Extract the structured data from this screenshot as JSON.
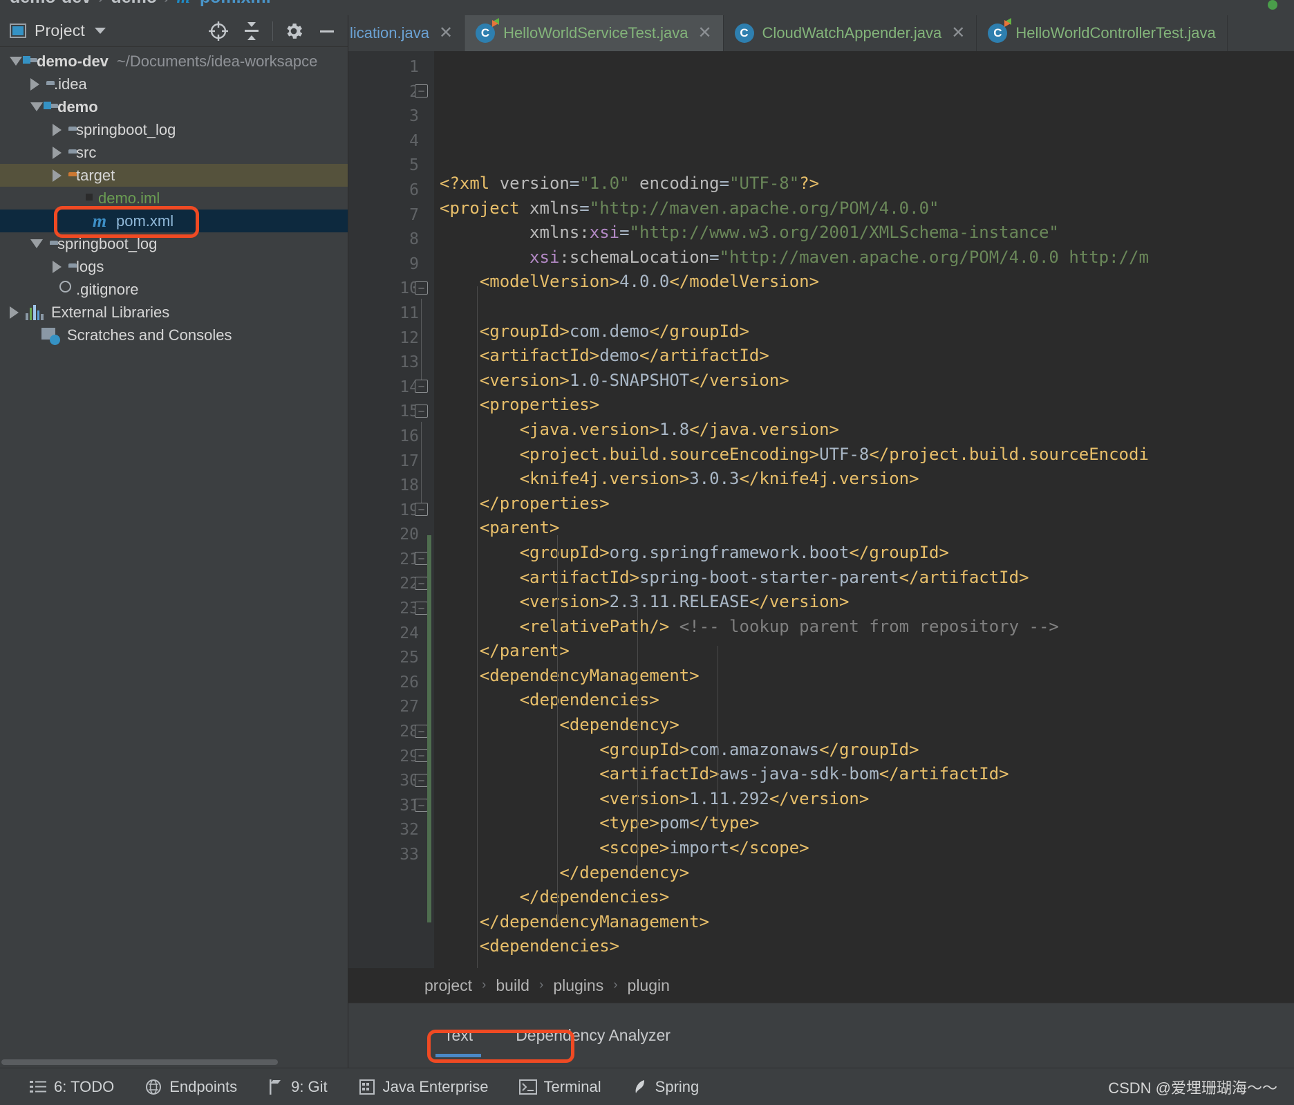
{
  "window": {
    "top_breadcrumb": {
      "project": "demo-dev",
      "module": "demo",
      "file": "pom.xml",
      "separator": "›",
      "maven_icon": "m"
    }
  },
  "project_panel": {
    "title": "Project",
    "window_icon": "project-window-icon",
    "dropdown_icon": "chevron-down-icon",
    "actions": [
      {
        "name": "locate-icon",
        "label": "⊕"
      },
      {
        "name": "collapse-all-icon",
        "label": "⇟"
      },
      {
        "name": "settings-gear-icon",
        "label": "⚙"
      },
      {
        "name": "hide-panel-icon",
        "label": "—"
      }
    ],
    "tree": [
      {
        "label": "demo-dev",
        "path": "~/Documents/idea-worksapce",
        "icon": "module-folder-icon",
        "twist": "open",
        "indent": 0,
        "style": "bold",
        "state": "normal"
      },
      {
        "label": ".idea",
        "path": "",
        "icon": "folder-icon",
        "twist": "closed",
        "indent": 1,
        "style": "normal",
        "state": "normal"
      },
      {
        "label": "demo",
        "path": "",
        "icon": "module-folder-icon",
        "twist": "open",
        "indent": 1,
        "style": "bold",
        "state": "normal"
      },
      {
        "label": "springboot_log",
        "path": "",
        "icon": "folder-icon",
        "twist": "closed",
        "indent": 2,
        "style": "normal",
        "state": "normal"
      },
      {
        "label": "src",
        "path": "",
        "icon": "folder-icon",
        "twist": "closed",
        "indent": 2,
        "style": "normal",
        "state": "normal"
      },
      {
        "label": "target",
        "path": "",
        "icon": "folder-orange-icon",
        "twist": "closed",
        "indent": 2,
        "style": "normal",
        "state": "selected-dir"
      },
      {
        "label": "demo.iml",
        "path": "",
        "icon": "iml-file-icon",
        "twist": "none",
        "indent": 3,
        "style": "green",
        "state": "normal"
      },
      {
        "label": "pom.xml",
        "path": "",
        "icon": "maven-file-icon",
        "twist": "none",
        "indent": 3,
        "style": "bluefile",
        "state": "selected-file"
      },
      {
        "label": "springboot_log",
        "path": "",
        "icon": "folder-icon",
        "twist": "open",
        "indent": 1,
        "style": "normal",
        "state": "normal"
      },
      {
        "label": "logs",
        "path": "",
        "icon": "folder-icon",
        "twist": "closed",
        "indent": 2,
        "style": "normal",
        "state": "normal"
      },
      {
        "label": ".gitignore",
        "path": "",
        "icon": "gitignore-file-icon",
        "twist": "none",
        "indent": 2,
        "style": "normal",
        "state": "normal"
      },
      {
        "label": "External Libraries",
        "path": "",
        "icon": "external-libraries-icon",
        "twist": "closed",
        "indent": 0,
        "style": "normal",
        "state": "normal"
      },
      {
        "label": "Scratches and Consoles",
        "path": "",
        "icon": "scratches-icon",
        "twist": "none",
        "indent": 0,
        "style": "normal",
        "state": "normal"
      }
    ]
  },
  "editor": {
    "tabs": [
      {
        "label": "lication.java",
        "icon": "java-class-icon",
        "active": false,
        "clipped": true,
        "closable": true
      },
      {
        "label": "HelloWorldServiceTest.java",
        "icon": "java-test-class-icon",
        "active": true,
        "clipped": false,
        "closable": true
      },
      {
        "label": "CloudWatchAppender.java",
        "icon": "java-class-icon",
        "active": false,
        "clipped": false,
        "closable": true
      },
      {
        "label": "HelloWorldControllerTest.java",
        "icon": "java-test-class-icon",
        "active": false,
        "clipped": false,
        "closable": false
      }
    ],
    "close_glyph": "✕",
    "first_line": 1,
    "last_line": 33,
    "lines": [
      {
        "n": 1,
        "tokens": [
          [
            "tg",
            "<?xml "
          ],
          [
            "at",
            "version"
          ],
          [
            "tx",
            "="
          ],
          [
            "st",
            "\"1.0\""
          ],
          [
            "at",
            " encoding"
          ],
          [
            "tx",
            "="
          ],
          [
            "st",
            "\"UTF-8\""
          ],
          [
            "tg",
            "?>"
          ]
        ]
      },
      {
        "n": 2,
        "tokens": [
          [
            "tg",
            "<project "
          ],
          [
            "at",
            "xmlns"
          ],
          [
            "tx",
            "="
          ],
          [
            "st",
            "\"http://maven.apache.org/POM/4.0.0\""
          ]
        ]
      },
      {
        "n": 3,
        "tokens": [
          [
            "tx",
            "         "
          ],
          [
            "at",
            "xmlns:"
          ],
          [
            "ns",
            "xsi"
          ],
          [
            "tx",
            "="
          ],
          [
            "st",
            "\"http://www.w3.org/2001/XMLSchema-instance\""
          ]
        ]
      },
      {
        "n": 4,
        "tokens": [
          [
            "tx",
            "         "
          ],
          [
            "ns",
            "xsi"
          ],
          [
            "at",
            ":schemaLocation"
          ],
          [
            "tx",
            "="
          ],
          [
            "st",
            "\"http://maven.apache.org/POM/4.0.0 http://m"
          ]
        ]
      },
      {
        "n": 5,
        "tokens": [
          [
            "tx",
            "    "
          ],
          [
            "tg",
            "<modelVersion>"
          ],
          [
            "tx",
            "4.0.0"
          ],
          [
            "tg",
            "</modelVersion>"
          ]
        ]
      },
      {
        "n": 6,
        "tokens": [
          [
            "tx",
            ""
          ]
        ]
      },
      {
        "n": 7,
        "tokens": [
          [
            "tx",
            "    "
          ],
          [
            "tg",
            "<groupId>"
          ],
          [
            "tx",
            "com.demo"
          ],
          [
            "tg",
            "</groupId>"
          ]
        ]
      },
      {
        "n": 8,
        "tokens": [
          [
            "tx",
            "    "
          ],
          [
            "tg",
            "<artifactId>"
          ],
          [
            "tx",
            "demo"
          ],
          [
            "tg",
            "</artifactId>"
          ]
        ]
      },
      {
        "n": 9,
        "tokens": [
          [
            "tx",
            "    "
          ],
          [
            "tg",
            "<version>"
          ],
          [
            "tx",
            "1.0-SNAPSHOT"
          ],
          [
            "tg",
            "</version>"
          ]
        ]
      },
      {
        "n": 10,
        "tokens": [
          [
            "tx",
            "    "
          ],
          [
            "tg",
            "<properties>"
          ]
        ]
      },
      {
        "n": 11,
        "tokens": [
          [
            "tx",
            "        "
          ],
          [
            "tg",
            "<java.version>"
          ],
          [
            "tx",
            "1.8"
          ],
          [
            "tg",
            "</java.version>"
          ]
        ]
      },
      {
        "n": 12,
        "tokens": [
          [
            "tx",
            "        "
          ],
          [
            "tg",
            "<project.build.sourceEncoding>"
          ],
          [
            "tx",
            "UTF-8"
          ],
          [
            "tg",
            "</project.build.sourceEncodi"
          ]
        ]
      },
      {
        "n": 13,
        "tokens": [
          [
            "tx",
            "        "
          ],
          [
            "tg",
            "<knife4j.version>"
          ],
          [
            "tx",
            "3.0.3"
          ],
          [
            "tg",
            "</knife4j.version>"
          ]
        ]
      },
      {
        "n": 14,
        "tokens": [
          [
            "tx",
            "    "
          ],
          [
            "tg",
            "</properties>"
          ]
        ]
      },
      {
        "n": 15,
        "tokens": [
          [
            "tx",
            "    "
          ],
          [
            "tg",
            "<parent>"
          ]
        ]
      },
      {
        "n": 16,
        "tokens": [
          [
            "tx",
            "        "
          ],
          [
            "tg",
            "<groupId>"
          ],
          [
            "tx",
            "org.springframework.boot"
          ],
          [
            "tg",
            "</groupId>"
          ]
        ]
      },
      {
        "n": 17,
        "tokens": [
          [
            "tx",
            "        "
          ],
          [
            "tg",
            "<artifactId>"
          ],
          [
            "tx",
            "spring-boot-starter-parent"
          ],
          [
            "tg",
            "</artifactId>"
          ]
        ]
      },
      {
        "n": 18,
        "tokens": [
          [
            "tx",
            "        "
          ],
          [
            "tg",
            "<version>"
          ],
          [
            "tx",
            "2.3.11.RELEASE"
          ],
          [
            "tg",
            "</version>"
          ]
        ]
      },
      {
        "n": 19,
        "tokens": [
          [
            "tx",
            "        "
          ],
          [
            "tg",
            "<relativePath/>"
          ],
          [
            "cm",
            " <!-- lookup parent from repository -->"
          ]
        ]
      },
      {
        "n": 20,
        "tokens": [
          [
            "tx",
            "    "
          ],
          [
            "tg",
            "</parent>"
          ]
        ]
      },
      {
        "n": 21,
        "tokens": [
          [
            "tx",
            "    "
          ],
          [
            "tg",
            "<dependencyManagement>"
          ]
        ]
      },
      {
        "n": 22,
        "tokens": [
          [
            "tx",
            "        "
          ],
          [
            "tg",
            "<dependencies>"
          ]
        ]
      },
      {
        "n": 23,
        "tokens": [
          [
            "tx",
            "            "
          ],
          [
            "tg",
            "<dependency>"
          ]
        ]
      },
      {
        "n": 24,
        "tokens": [
          [
            "tx",
            "                "
          ],
          [
            "tg",
            "<groupId>"
          ],
          [
            "tx",
            "com.amazonaws"
          ],
          [
            "tg",
            "</groupId>"
          ]
        ]
      },
      {
        "n": 25,
        "tokens": [
          [
            "tx",
            "                "
          ],
          [
            "tg",
            "<artifactId>"
          ],
          [
            "tx",
            "aws-java-sdk-bom"
          ],
          [
            "tg",
            "</artifactId>"
          ]
        ]
      },
      {
        "n": 26,
        "tokens": [
          [
            "tx",
            "                "
          ],
          [
            "tg",
            "<version>"
          ],
          [
            "tx",
            "1.11.292"
          ],
          [
            "tg",
            "</version>"
          ]
        ]
      },
      {
        "n": 27,
        "tokens": [
          [
            "tx",
            "                "
          ],
          [
            "tg",
            "<type>"
          ],
          [
            "tx",
            "pom"
          ],
          [
            "tg",
            "</type>"
          ]
        ]
      },
      {
        "n": 28,
        "tokens": [
          [
            "tx",
            "                "
          ],
          [
            "tg",
            "<scope>"
          ],
          [
            "tx",
            "import"
          ],
          [
            "tg",
            "</scope>"
          ]
        ]
      },
      {
        "n": 29,
        "tokens": [
          [
            "tx",
            "            "
          ],
          [
            "tg",
            "</dependency>"
          ]
        ]
      },
      {
        "n": 30,
        "tokens": [
          [
            "tx",
            "        "
          ],
          [
            "tg",
            "</dependencies>"
          ]
        ]
      },
      {
        "n": 31,
        "tokens": [
          [
            "tx",
            "    "
          ],
          [
            "tg",
            "</dependencyManagement>"
          ]
        ]
      },
      {
        "n": 32,
        "tokens": [
          [
            "tx",
            "    "
          ],
          [
            "tg",
            "<dependencies>"
          ]
        ]
      },
      {
        "n": 33,
        "tokens": [
          [
            "tx",
            ""
          ]
        ]
      }
    ],
    "breadcrumbs": [
      "project",
      "build",
      "plugins",
      "plugin"
    ],
    "breadcrumb_separator": "›",
    "bottom_tabs": [
      {
        "label": "Text",
        "active": true
      },
      {
        "label": "Dependency Analyzer",
        "active": false
      }
    ]
  },
  "status_bar": {
    "items": [
      {
        "label": "6: TODO",
        "icon": "todo-list-icon",
        "mnemonic": "6"
      },
      {
        "label": "Endpoints",
        "icon": "endpoints-globe-icon",
        "mnemonic": ""
      },
      {
        "label": "9: Git",
        "icon": "git-branch-icon",
        "mnemonic": "9"
      },
      {
        "label": "Java Enterprise",
        "icon": "java-enterprise-icon",
        "mnemonic": ""
      },
      {
        "label": "Terminal",
        "icon": "terminal-icon",
        "mnemonic": ""
      },
      {
        "label": "Spring",
        "icon": "spring-leaf-icon",
        "mnemonic": ""
      }
    ],
    "watermark": "CSDN @爱埋珊瑚海～～"
  },
  "annotations": {
    "highlight_color": "#f04a23",
    "boxes": [
      "pom-xml-tree-item",
      "dependency-analyzer-tab"
    ]
  },
  "colors": {
    "panel_bg": "#3c3f41",
    "editor_bg": "#2b2b2b",
    "gutter_bg": "#313335",
    "selected_file_bg": "#0d293e",
    "selected_dir_bg": "#55523c",
    "tag": "#e8bf6a",
    "string": "#6a8759",
    "text": "#a9b7c6",
    "comment": "#808080",
    "accent_blue": "#4a88c7",
    "tab_text_green": "#83b47a"
  }
}
